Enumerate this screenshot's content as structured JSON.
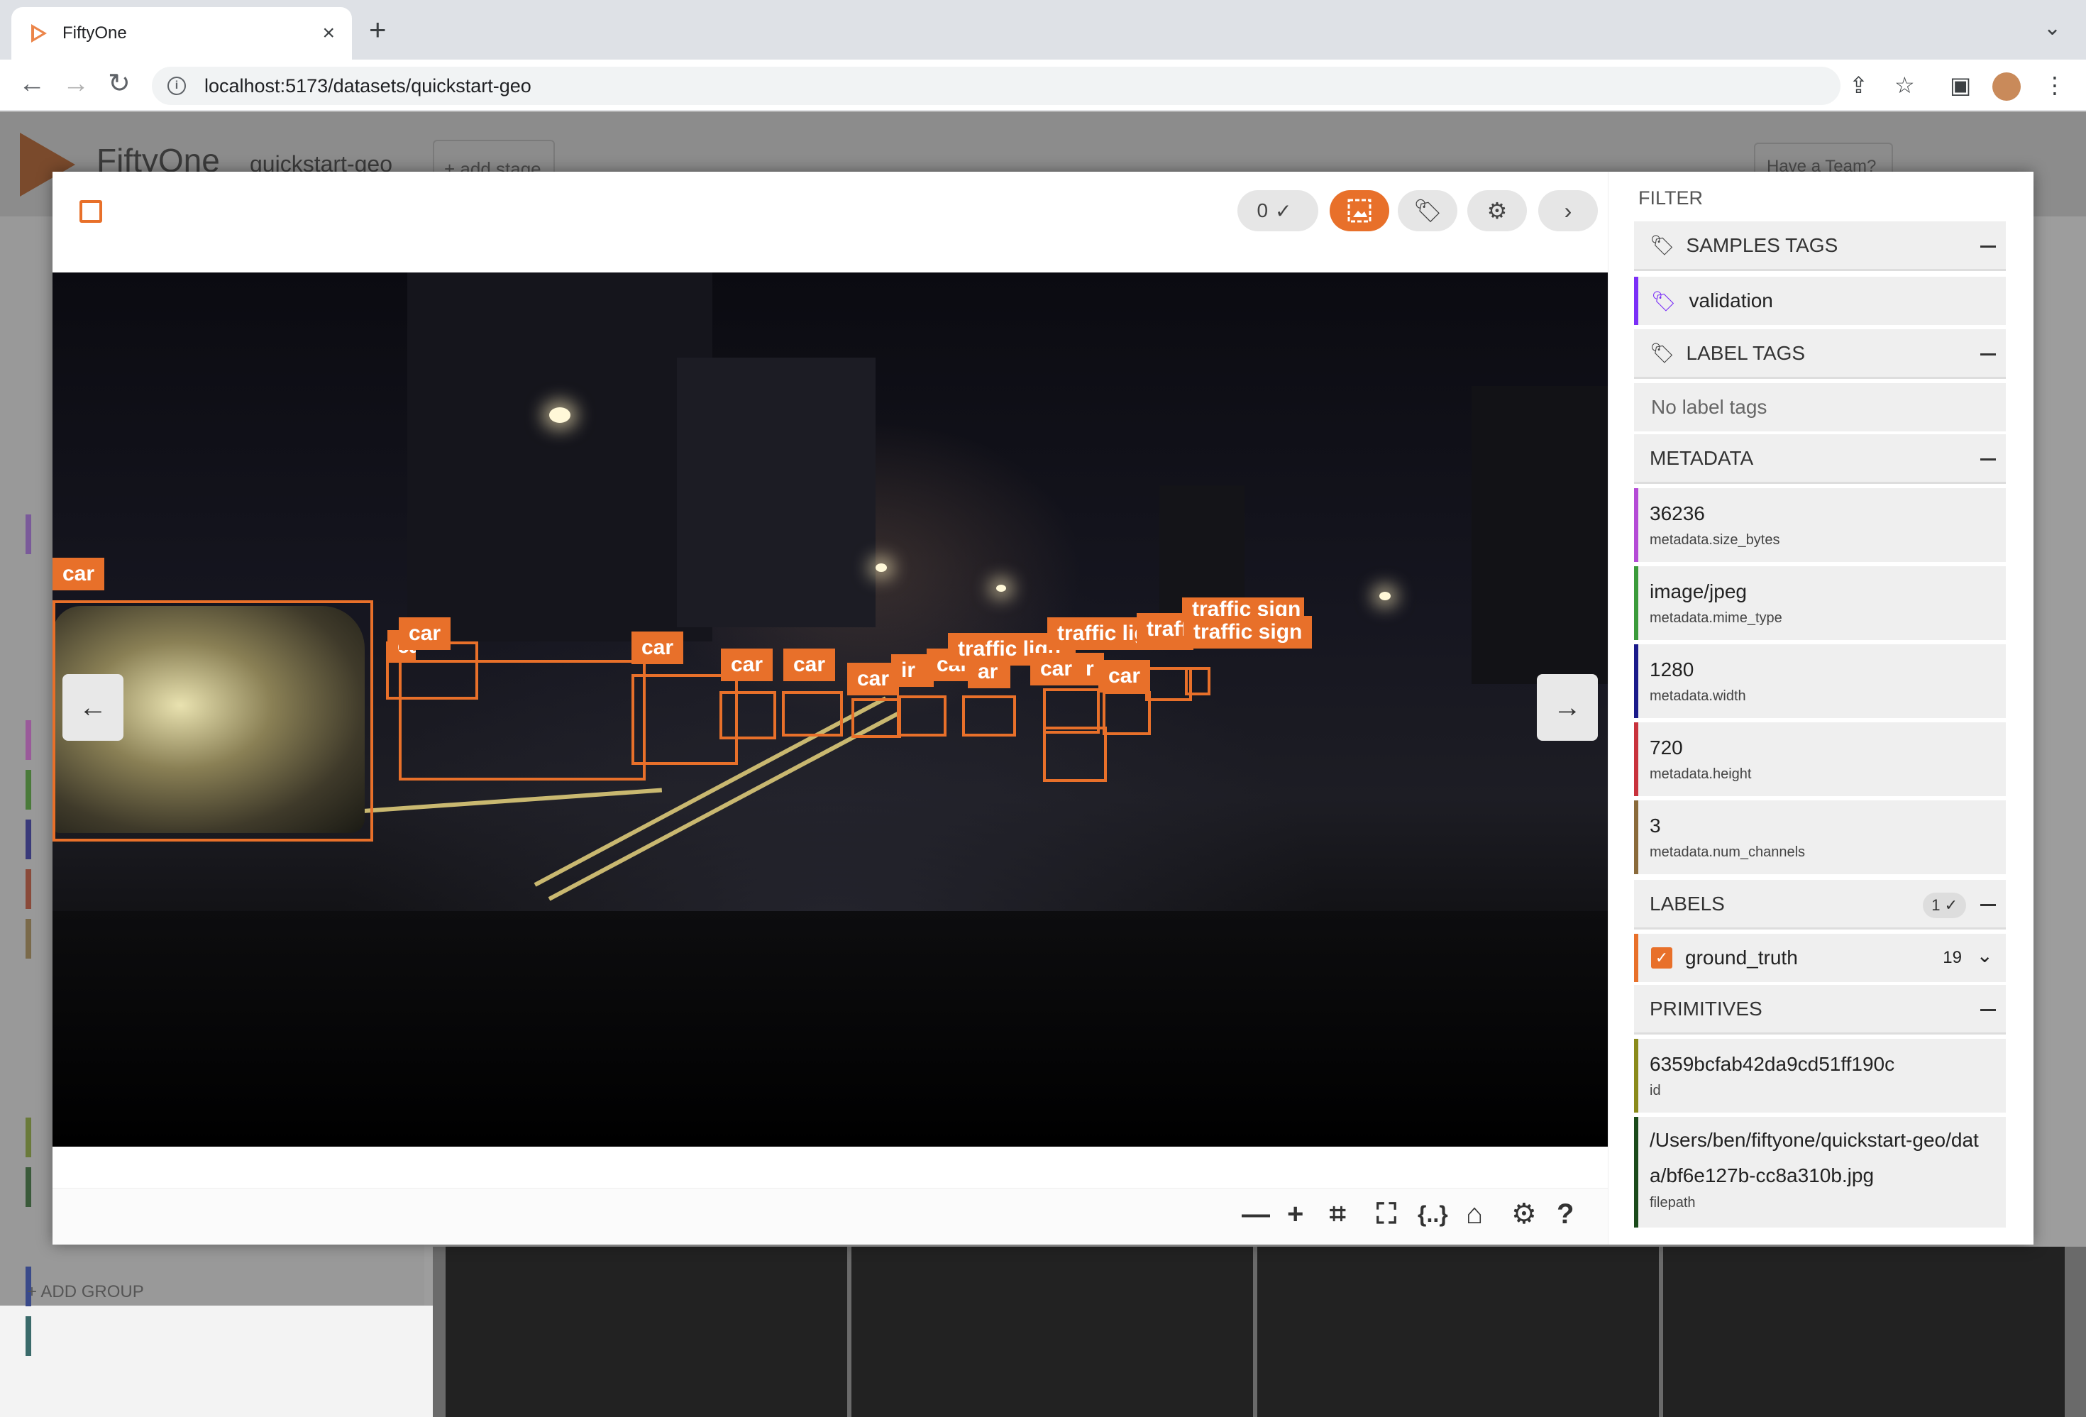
{
  "browser": {
    "tab_title": "FiftyOne",
    "url": "localhost:5173/datasets/quickstart-geo",
    "close_glyph": "×",
    "newtab_glyph": "+"
  },
  "app": {
    "name": "FiftyOne",
    "dataset": "quickstart-geo",
    "add_stage": "+ add stage",
    "have_team": "Have a Team?",
    "add_group": "+ ADD GROUP"
  },
  "modal": {
    "selected_count": "0",
    "detections": [
      {
        "label": "car"
      },
      {
        "label": "car"
      },
      {
        "label": "ca"
      },
      {
        "label": "car"
      },
      {
        "label": "car"
      },
      {
        "label": "car"
      },
      {
        "label": "car"
      },
      {
        "label": "ir"
      },
      {
        "label": "car"
      },
      {
        "label": "car"
      },
      {
        "label": "ar"
      },
      {
        "label": "traffic ligh"
      },
      {
        "label": "car"
      },
      {
        "label": "r"
      },
      {
        "label": "car"
      },
      {
        "label": "traffic lig"
      },
      {
        "label": "traffi"
      },
      {
        "label": "traffic sign"
      },
      {
        "label": "traffic sign"
      }
    ]
  },
  "sidebar": {
    "filter_title": "FILTER",
    "samples_tags": {
      "title": "SAMPLES TAGS",
      "items": [
        {
          "label": "validation",
          "color": "#7b2ff7"
        }
      ]
    },
    "label_tags": {
      "title": "LABEL TAGS",
      "empty": "No label tags"
    },
    "metadata": {
      "title": "METADATA",
      "fields": [
        {
          "value": "36236",
          "key": "metadata.size_bytes",
          "color": "#b44bd6"
        },
        {
          "value": "image/jpeg",
          "key": "metadata.mime_type",
          "color": "#3a9b3a"
        },
        {
          "value": "1280",
          "key": "metadata.width",
          "color": "#1a1a8a"
        },
        {
          "value": "720",
          "key": "metadata.height",
          "color": "#c8323c"
        },
        {
          "value": "3",
          "key": "metadata.num_channels",
          "color": "#8a6a3a"
        }
      ]
    },
    "labels": {
      "title": "LABELS",
      "badge": "1",
      "field": "ground_truth",
      "count": "19"
    },
    "primitives": {
      "title": "PRIMITIVES",
      "fields": [
        {
          "value": "6359bcfab42da9cd51ff190c",
          "key": "id",
          "color": "#8a8a1a"
        },
        {
          "value": "/Users/ben/fiftyone/quickstart-geo/data/bf6e127b-cc8a310b.jpg",
          "key": "filepath",
          "color": "#1a4a1a"
        }
      ]
    }
  },
  "colors": {
    "accent": "#e8702a"
  }
}
